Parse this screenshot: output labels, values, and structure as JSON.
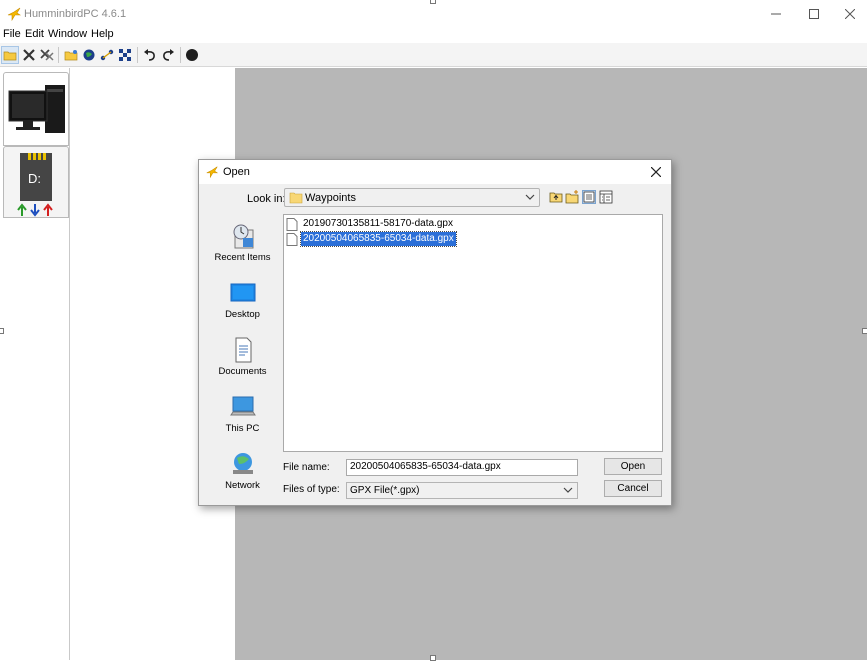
{
  "app": {
    "title": "HumminbirdPC 4.6.1"
  },
  "menu": {
    "items": [
      "File",
      "Edit",
      "Window",
      "Help"
    ]
  },
  "toolbar": {
    "icons": [
      "open-folder-icon",
      "delete-icon",
      "delete-all-icon",
      "open-folder-icon",
      "globe-icon",
      "route-icon",
      "grid-icon",
      "undo-icon",
      "redo-icon",
      "stop-icon"
    ]
  },
  "devices": {
    "computer": {
      "icon": "computer-icon"
    },
    "sd_card": {
      "label": "D:",
      "icon": "sd-card-icon"
    }
  },
  "dialog": {
    "title": "Open",
    "look_in_label": "Look in:",
    "look_in_value": "Waypoints",
    "places": [
      "Recent Items",
      "Desktop",
      "Documents",
      "This PC",
      "Network"
    ],
    "files": [
      {
        "name": "20190730135811-58170-data.gpx",
        "selected": false
      },
      {
        "name": "20200504065835-65034-data.gpx",
        "selected": true
      }
    ],
    "file_name_label": "File name:",
    "file_name_value": "20200504065835-65034-data.gpx",
    "file_type_label": "Files of type:",
    "file_type_value": "GPX File(*.gpx)",
    "open_label": "Open",
    "cancel_label": "Cancel"
  },
  "colors": {
    "selection": "#2b6fd8",
    "canvas": "#b7b7b7",
    "accent": "#f5b800"
  }
}
